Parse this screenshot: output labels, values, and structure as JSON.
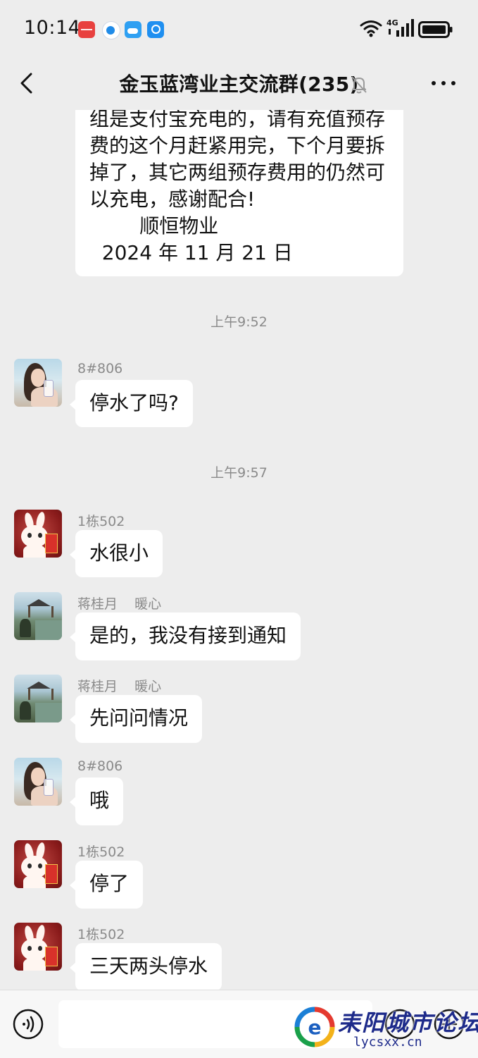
{
  "status_bar": {
    "time": "10:14",
    "app_icons": [
      "huawei-store-icon",
      "send-app-icon",
      "weather-app-icon",
      "search-app-icon"
    ],
    "network": "4G"
  },
  "header": {
    "title": "金玉蓝湾业主交流群(235)",
    "back_icon": "chevron-left-icon",
    "mute_icon": "bell-muted-icon",
    "more_icon": "ellipsis-icon"
  },
  "messages": {
    "announcement": {
      "lines": [
        "组是支付宝充电的，请有充值预存",
        "费的这个月赶紧用完，下个月要拆",
        "掉了，其它两组预存费用的仍然可",
        "以充电，感谢配合!",
        "        顺恒物业",
        "  2024 年 11 月 21 日"
      ]
    },
    "time1": "上午9:52",
    "m1": {
      "sender": "8#806",
      "text": "停水了吗?"
    },
    "time2": "上午9:57",
    "m2": {
      "sender": "1栋502",
      "text": "水很小"
    },
    "m3": {
      "sender": "蒋桂月    暖心",
      "text": "是的，我没有接到通知"
    },
    "m4": {
      "sender": "蒋桂月    暖心",
      "text": "先问问情况"
    },
    "m5": {
      "sender": "8#806",
      "text": "哦"
    },
    "m6": {
      "sender": "1栋502",
      "text": "停了"
    },
    "m7": {
      "sender": "1栋502",
      "text": "三天两头停水"
    }
  },
  "input_bar": {
    "value": "",
    "placeholder": "",
    "voice_icon": "voice-input-icon",
    "emoji_icon": "emoji-icon",
    "plus_icon": "plus-icon"
  },
  "watermark": {
    "text": "耒阳城市论坛",
    "url": "lycsxx.cn"
  },
  "colors": {
    "background": "#ededed",
    "bubble": "#ffffff",
    "text": "#111111",
    "meta": "#8a8a8a",
    "watermark": "#1d2a8a"
  }
}
